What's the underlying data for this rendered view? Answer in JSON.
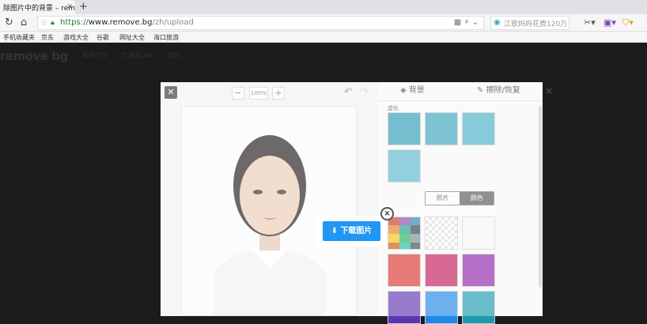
{
  "browser": {
    "tab_title": "除图片中的背景 – remove.bg",
    "tab_close": "×",
    "new_tab": "+",
    "url_scheme": "https://",
    "url_host": "www.remove.bg",
    "url_path": "/zh/upload",
    "search_placeholder": "江歌妈妈花费120万",
    "bookmarks": [
      "手机收藏夹",
      "京东",
      "游戏大全",
      "谷歌",
      "网址大全",
      "海口旅游"
    ]
  },
  "site": {
    "logo": "remove bg",
    "nav": [
      "如何工作",
      "工具和 API",
      "定价"
    ]
  },
  "editor": {
    "close": "✕",
    "zoom_minus": "−",
    "zoom_value": "100%",
    "zoom_plus": "+",
    "undo": "↶",
    "redo": "↷",
    "tab_background": "背景",
    "tab_erase": "擦除/恢复",
    "section_blur": "虚化",
    "seg_photo": "照片",
    "seg_color": "颜色",
    "modal_close": "×",
    "colors": {
      "accent": "#2196f3",
      "tile_red": "#d9342b",
      "tile_crimson": "#c2185b",
      "tile_purple": "#8e24aa",
      "tile_violet": "#5e35b1",
      "tile_blue": "#1e88e5",
      "tile_teal": "#1e9ab0"
    }
  },
  "download_popup": {
    "button_label": "下载图片",
    "close": "×"
  }
}
